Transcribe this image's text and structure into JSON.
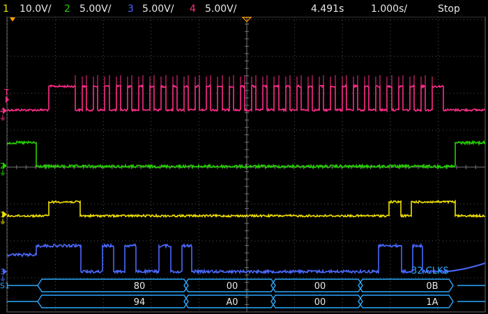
{
  "header": {
    "ch1": {
      "num": "1",
      "scale": "10.0V/",
      "color": "#f0e000"
    },
    "ch2": {
      "num": "2",
      "scale": "5.00V/",
      "color": "#25d000"
    },
    "ch3": {
      "num": "3",
      "scale": "5.00V/",
      "color": "#4a68ff"
    },
    "ch4": {
      "num": "4",
      "scale": "5.00V/",
      "color": "#ff2d8a"
    },
    "time_pos": "4.491s",
    "time_scale": "1.000s/",
    "run_state": "Stop"
  },
  "markers": {
    "trigger": "T",
    "ch4": "4",
    "ch2": "2",
    "ch1": "1",
    "ch3": "3",
    "serial": "S1"
  },
  "annotation": "32 CLKS",
  "serial_rows": [
    {
      "values": [
        "80",
        "00",
        "00",
        "0B"
      ]
    },
    {
      "values": [
        "94",
        "A0",
        "00",
        "1A"
      ]
    }
  ],
  "colors": {
    "ch1": "#f0e000",
    "ch2": "#25d000",
    "ch3": "#4a68ff",
    "ch4": "#ff2d8a",
    "serial": "#2aa9ff",
    "grid": "#555555",
    "trigger": "#ff9a00"
  }
}
